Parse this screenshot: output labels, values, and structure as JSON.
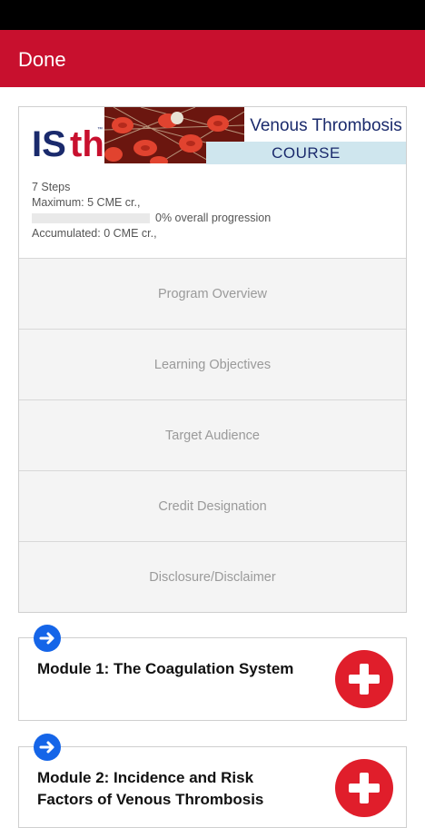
{
  "appbar": {
    "done_label": "Done",
    "color": "#c8102e"
  },
  "course": {
    "logo_text": "ISth",
    "banner_title": "Venous Thrombosis",
    "banner_badge": "COURSE",
    "steps": "7 Steps",
    "maximum": "Maximum: 5 CME cr.,",
    "progress_label": "0% overall progression",
    "progress_value": 0,
    "accumulated": "Accumulated: 0 CME cr.,"
  },
  "menu": [
    {
      "label": "Program Overview"
    },
    {
      "label": "Learning Objectives"
    },
    {
      "label": "Target Audience"
    },
    {
      "label": "Credit Designation"
    },
    {
      "label": "Disclosure/Disclaimer"
    }
  ],
  "modules": [
    {
      "title": "Module 1: The Coagulation System"
    },
    {
      "title": "Module 2: Incidence and Risk Factors of Venous Thrombosis"
    }
  ],
  "colors": {
    "accent": "#c8102e",
    "plus": "#e01e2b",
    "arrow": "#1565e8"
  }
}
